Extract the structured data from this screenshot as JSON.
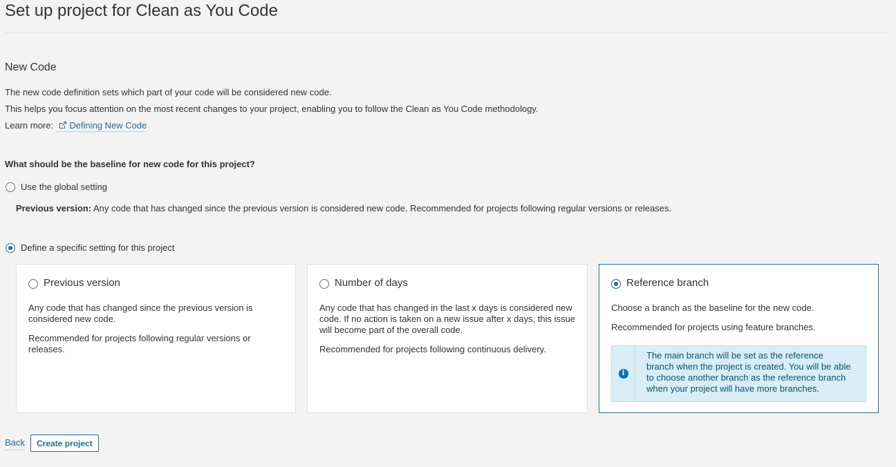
{
  "page": {
    "title": "Set up project for Clean as You Code"
  },
  "new_code": {
    "title": "New Code",
    "desc1": "The new code definition sets which part of your code will be considered new code.",
    "desc2": "This helps you focus attention on the most recent changes to your project, enabling you to follow the Clean as You Code methodology.",
    "learn_more_label": "Learn more:",
    "learn_more_link": "Defining New Code",
    "link_icon": "external-link-icon"
  },
  "baseline": {
    "question": "What should be the baseline for new code for this project?",
    "global_option": {
      "label": "Use the global setting",
      "checked": false,
      "desc_bold": "Previous version:",
      "desc_rest": " Any code that has changed since the previous version is considered new code. Recommended for projects following regular versions or releases."
    },
    "specific_option": {
      "label": "Define a specific setting for this project",
      "checked": true
    },
    "cards": [
      {
        "title": "Previous version",
        "checked": false,
        "text1": "Any code that has changed since the previous version is considered new code.",
        "text2": "Recommended for projects following regular versions or releases."
      },
      {
        "title": "Number of days",
        "checked": false,
        "text1": "Any code that has changed in the last x days is considered new code. If no action is taken on a new issue after x days, this issue will become part of the overall code.",
        "text2": "Recommended for projects following continuous delivery."
      },
      {
        "title": "Reference branch",
        "checked": true,
        "text1": "Choose a branch as the baseline for the new code.",
        "text2": "Recommended for projects using feature branches.",
        "info_icon": "info-icon",
        "info": "The main branch will be set as the reference branch when the project is created. You will be able to choose another branch as the reference branch when your project will have more branches."
      }
    ]
  },
  "actions": {
    "back": "Back",
    "create": "Create project"
  },
  "colors": {
    "accent": "#236a97",
    "info_bg": "#d9edf7",
    "info_text": "#0e516f",
    "info_icon": "#0271b9"
  }
}
